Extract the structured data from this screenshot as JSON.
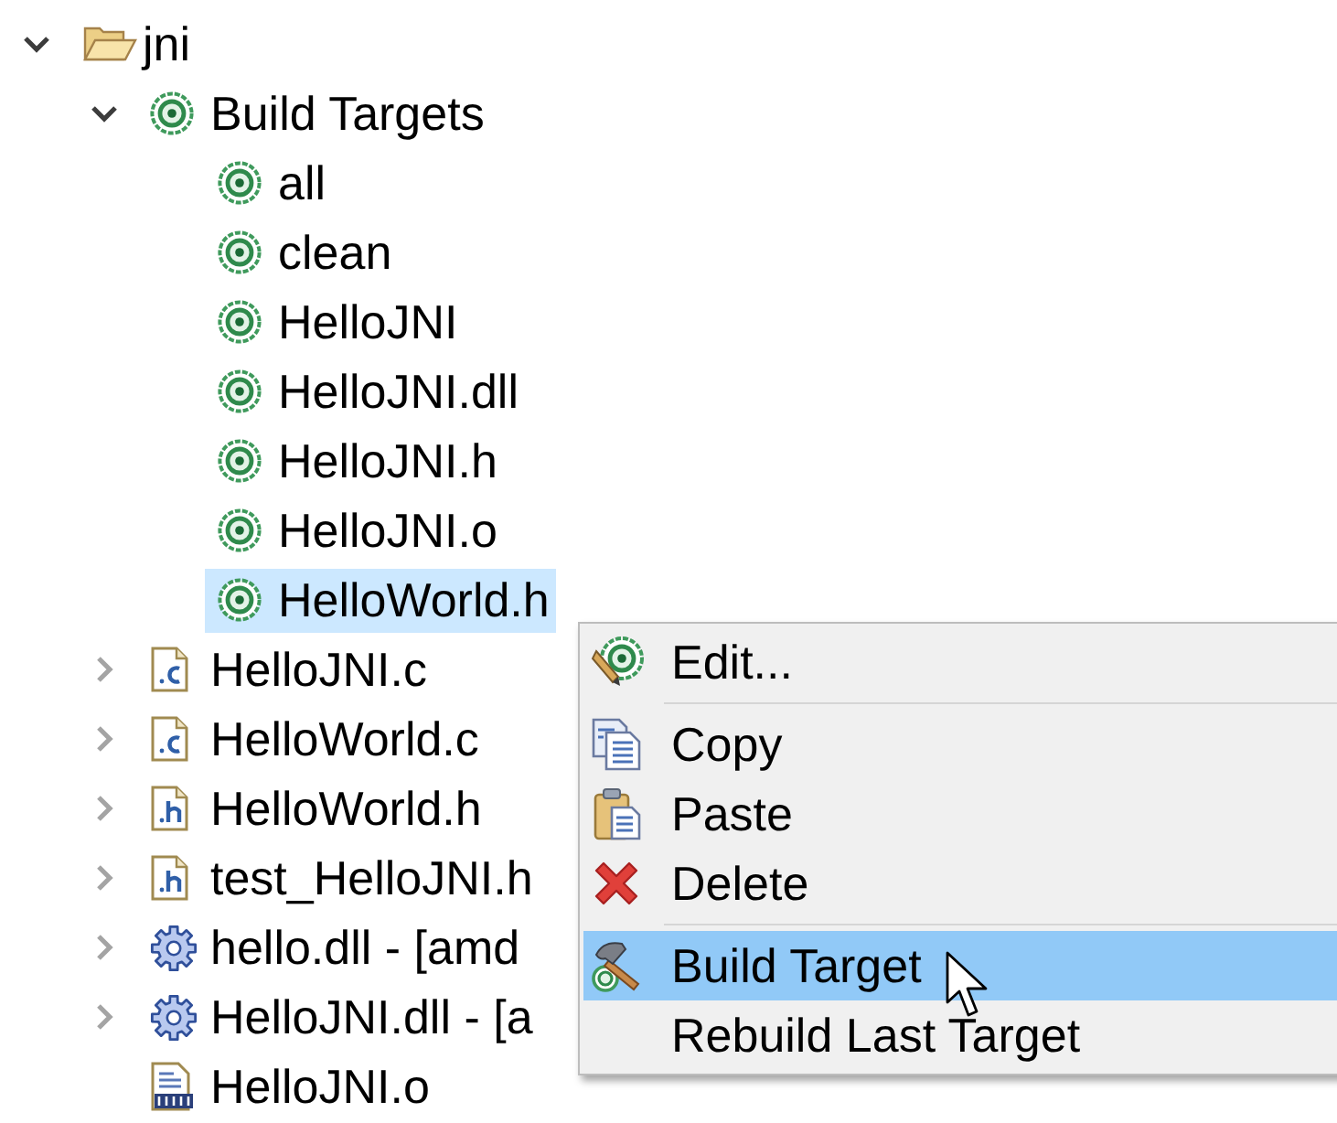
{
  "tree": [
    {
      "label": "jni",
      "kind": "folder",
      "expanded": true,
      "selected": false,
      "children": [
        {
          "label": "Build Targets",
          "kind": "target-group",
          "expanded": true,
          "selected": false,
          "children": [
            {
              "label": "all",
              "kind": "target",
              "selected": false
            },
            {
              "label": "clean",
              "kind": "target",
              "selected": false
            },
            {
              "label": "HelloJNI",
              "kind": "target",
              "selected": false
            },
            {
              "label": "HelloJNI.dll",
              "kind": "target",
              "selected": false
            },
            {
              "label": "HelloJNI.h",
              "kind": "target",
              "selected": false
            },
            {
              "label": "HelloJNI.o",
              "kind": "target",
              "selected": false
            },
            {
              "label": "HelloWorld.h",
              "kind": "target",
              "selected": true
            }
          ]
        },
        {
          "label": "HelloJNI.c",
          "kind": "source",
          "expanded": false,
          "selected": false
        },
        {
          "label": "HelloWorld.c",
          "kind": "source",
          "expanded": false,
          "selected": false
        },
        {
          "label": "HelloWorld.h",
          "kind": "header",
          "expanded": false,
          "selected": false
        },
        {
          "label": "test_HelloJNI.h",
          "kind": "header",
          "expanded": false,
          "selected": false
        },
        {
          "label": "hello.dll - [amd",
          "kind": "library",
          "expanded": false,
          "selected": false
        },
        {
          "label": "HelloJNI.dll - [a",
          "kind": "library",
          "expanded": false,
          "selected": false
        },
        {
          "label": "HelloJNI.o",
          "kind": "object",
          "selected": false
        }
      ]
    }
  ],
  "context_menu": {
    "items": [
      {
        "kind": "item",
        "label": "Edit...",
        "selected": false
      },
      {
        "kind": "separator"
      },
      {
        "kind": "item",
        "label": "Copy",
        "selected": false
      },
      {
        "kind": "item",
        "label": "Paste",
        "selected": false
      },
      {
        "kind": "item",
        "label": "Delete",
        "selected": false
      },
      {
        "kind": "separator"
      },
      {
        "kind": "item",
        "label": "Build Target",
        "selected": true
      },
      {
        "kind": "item",
        "label": "Rebuild Last Target",
        "selected": false
      }
    ]
  }
}
